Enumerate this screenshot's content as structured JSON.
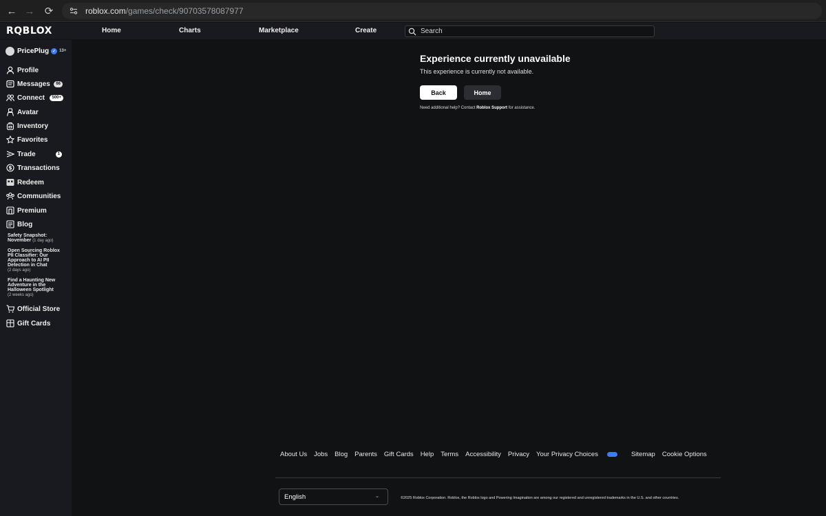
{
  "browser": {
    "url_host": "roblox.com",
    "url_path": "/games/check/90703578087977"
  },
  "header": {
    "logo": "RQBLOX",
    "nav": [
      "Home",
      "Charts",
      "Marketplace",
      "Create"
    ],
    "search_placeholder": "Search"
  },
  "sidebar": {
    "username": "PricePlug",
    "age_label": "13+",
    "items": [
      {
        "label": "Profile",
        "icon": "person-icon"
      },
      {
        "label": "Messages",
        "icon": "message-icon",
        "badge": "66"
      },
      {
        "label": "Connect",
        "icon": "friends-icon",
        "badge": "500+"
      },
      {
        "label": "Avatar",
        "icon": "avatar-icon"
      },
      {
        "label": "Inventory",
        "icon": "backpack-icon"
      },
      {
        "label": "Favorites",
        "icon": "star-icon"
      },
      {
        "label": "Trade",
        "icon": "trade-icon",
        "badge": "1"
      },
      {
        "label": "Transactions",
        "icon": "dollar-icon"
      },
      {
        "label": "Redeem",
        "icon": "gift-card-icon"
      },
      {
        "label": "Communities",
        "icon": "group-icon"
      },
      {
        "label": "Premium",
        "icon": "premium-icon"
      },
      {
        "label": "Blog",
        "icon": "blog-icon"
      }
    ],
    "blog_posts": [
      {
        "title": "Safety Snapshot: November",
        "ago": "(1 day ago)"
      },
      {
        "title": "Open Sourcing Roblox PII Classifier: Our Approach to AI PII Detection in Chat",
        "ago": "(2 days ago)"
      },
      {
        "title": "Find a Haunting New Adventure in the Halloween Spotlight",
        "ago": "(2 weeks ago)"
      }
    ],
    "bottom_items": [
      {
        "label": "Official Store",
        "icon": "cart-icon"
      },
      {
        "label": "Gift Cards",
        "icon": "gift-icon"
      }
    ]
  },
  "main": {
    "title": "Experience currently unavailable",
    "message": "This experience is currently not available.",
    "back_label": "Back",
    "home_label": "Home",
    "help_prefix": "Need additional help? Contact ",
    "help_link": "Roblox Support",
    "help_suffix": " for assistance."
  },
  "footer": {
    "links": [
      "About Us",
      "Jobs",
      "Blog",
      "Parents",
      "Gift Cards",
      "Help",
      "Terms",
      "Accessibility",
      "Privacy",
      "Your Privacy Choices",
      "Sitemap",
      "Cookie Options"
    ],
    "language": "English",
    "copyright": "©2025 Roblox Corporation. Roblox, the Roblox logo and Powering Imagination are among our registered and unregistered trademarks in the U.S. and other countries."
  }
}
